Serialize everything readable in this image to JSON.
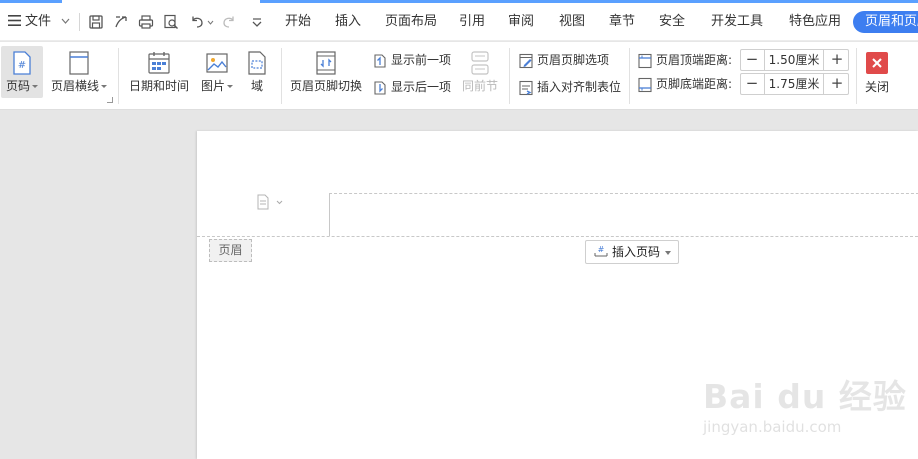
{
  "menubar": {
    "file_label": "文件",
    "tabs": [
      "开始",
      "插入",
      "页面布局",
      "引用",
      "审阅",
      "视图",
      "章节",
      "安全",
      "开发工具",
      "特色应用"
    ],
    "active_tab": "页眉和页脚"
  },
  "ribbon": {
    "page_number": "页码",
    "header_line": "页眉横线",
    "date_time": "日期和时间",
    "picture": "图片",
    "field": "域",
    "switch_header_footer": "页眉页脚切换",
    "show_previous": "显示前一项",
    "show_next": "显示后一项",
    "same_as_previous": "同前节",
    "header_footer_options": "页眉页脚选项",
    "insert_align_tab": "插入对齐制表位",
    "header_top_label": "页眉顶端距离:",
    "header_top_value": "1.50厘米",
    "footer_bottom_label": "页脚底端距离:",
    "footer_bottom_value": "1.75厘米",
    "close": "关闭"
  },
  "document": {
    "header_tag": "页眉",
    "insert_page_number": "插入页码"
  },
  "watermark": {
    "brand": "Bai du 经验",
    "url": "jingyan.baidu.com"
  },
  "colors": {
    "accent": "#3d7ef0",
    "close_red": "#e04a4a"
  }
}
